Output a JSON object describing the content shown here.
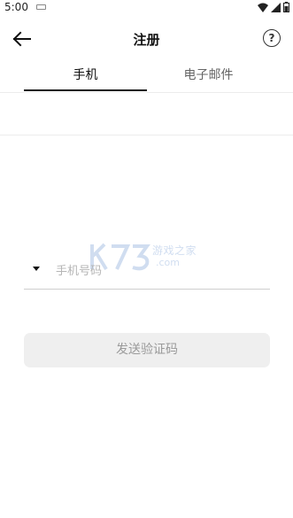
{
  "status_bar": {
    "time": "5:00"
  },
  "header": {
    "title": "注册"
  },
  "tabs": [
    {
      "label": "手机"
    },
    {
      "label": "电子邮件"
    }
  ],
  "phone_field": {
    "placeholder": "手机号码"
  },
  "send_button": {
    "label": "发送验证码"
  },
  "watermark": {
    "text": "游戏之家",
    "domain": ".com"
  }
}
